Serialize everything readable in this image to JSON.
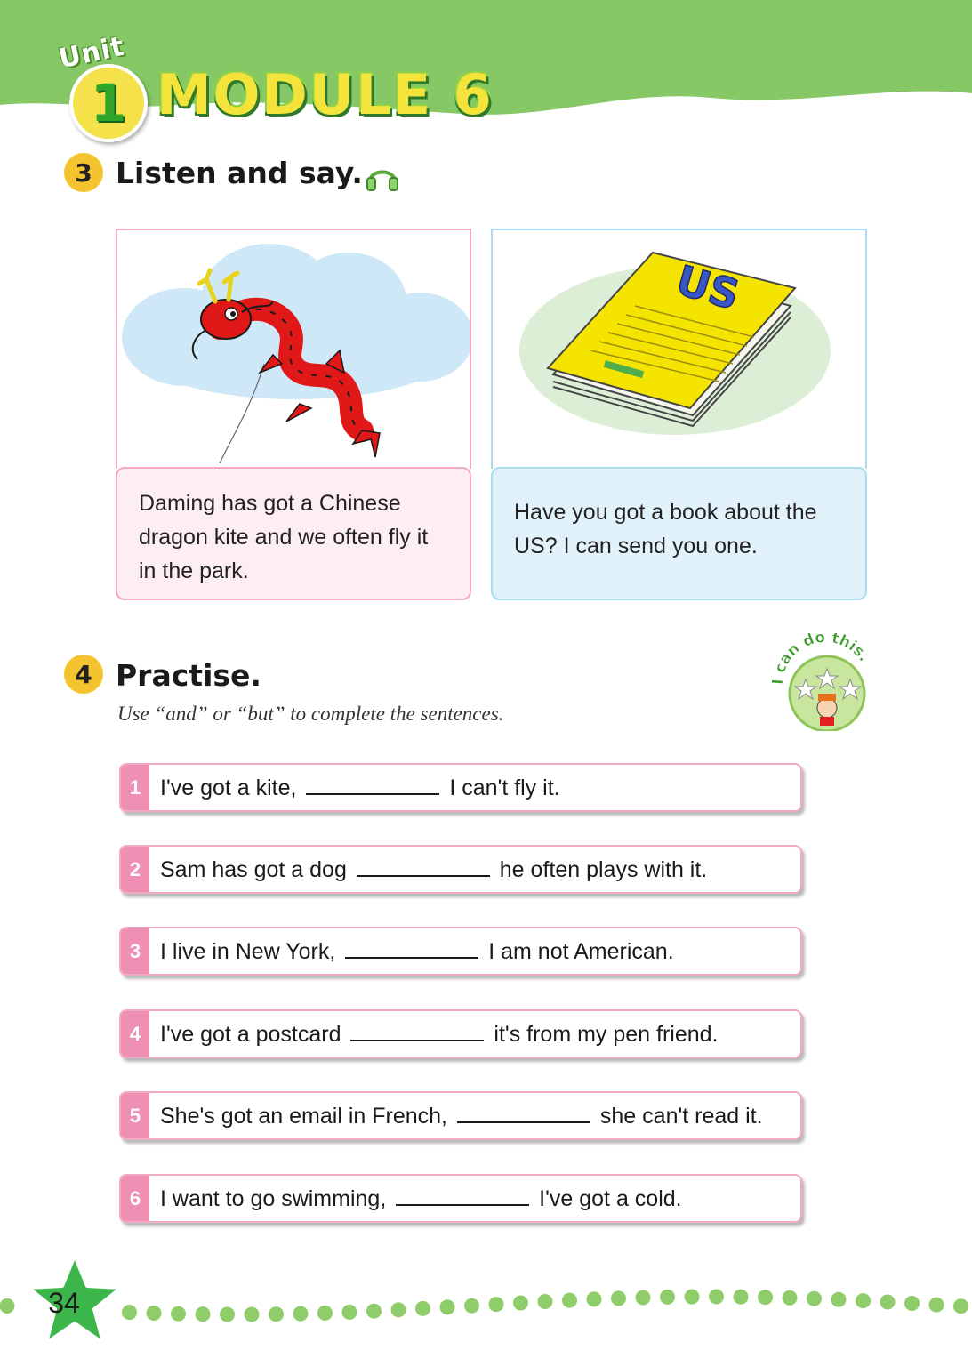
{
  "header": {
    "unit_word": "Unit",
    "unit_number": "1",
    "module_title": "MODULE 6"
  },
  "section3": {
    "number": "3",
    "title": "Listen and say.",
    "icon": "headphones-icon",
    "cards": [
      {
        "image": "dragon-kite",
        "text": "Daming has got a Chinese dragon kite and we often fly it in the park."
      },
      {
        "image": "book",
        "book_label": "US",
        "text": "Have you got a book about the US? I can send you one."
      }
    ]
  },
  "section4": {
    "number": "4",
    "title": "Practise.",
    "instruction": "Use “and” or “but” to complete the sentences.",
    "badge_text": "I can do this.",
    "exercises": [
      {
        "num": "1",
        "before": "I've got a kite,",
        "after": "I can't fly it."
      },
      {
        "num": "2",
        "before": "Sam has got a dog",
        "after": "he often plays with it."
      },
      {
        "num": "3",
        "before": "I live in New York,",
        "after": "I am not American."
      },
      {
        "num": "4",
        "before": "I've got a postcard",
        "after": "it's from my pen friend."
      },
      {
        "num": "5",
        "before": "She's got an email in French,",
        "after": "she can't read it."
      },
      {
        "num": "6",
        "before": "I want to go swimming,",
        "after": "I've got a cold."
      }
    ]
  },
  "footer": {
    "page_number": "34"
  },
  "colors": {
    "header_green": "#86c766",
    "section_yellow": "#f4c430",
    "card1_border": "#f2a9c4",
    "card1_bg": "#fdeef3",
    "card2_border": "#a9dcf2",
    "card2_bg": "#e2f2fb",
    "exercise_pink": "#ee8fb3",
    "dot_green": "#8fcc6a"
  }
}
